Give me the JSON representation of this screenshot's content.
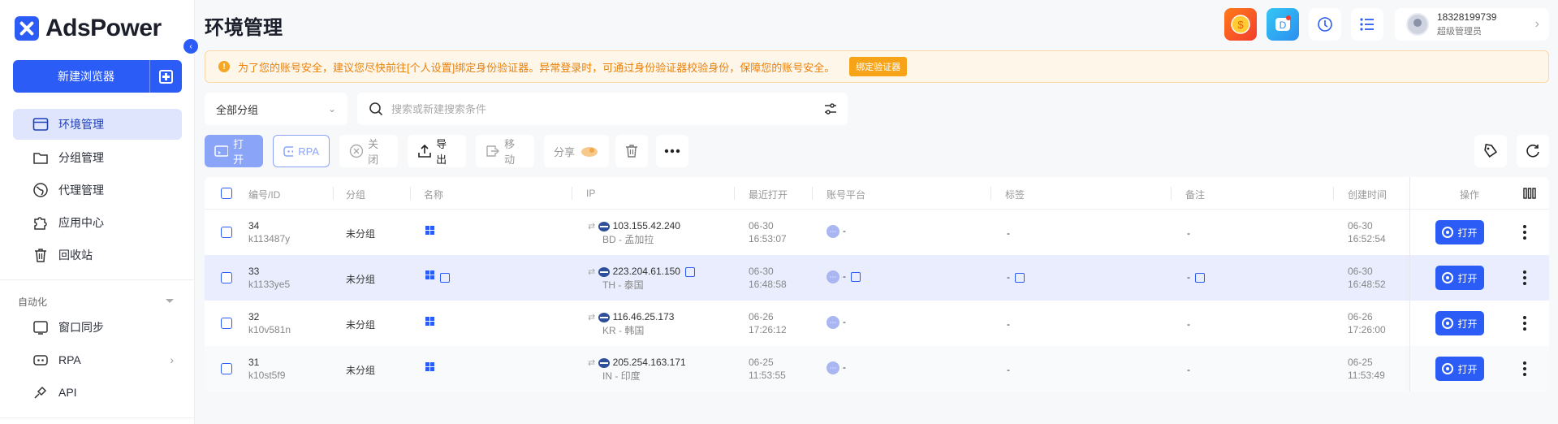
{
  "app": {
    "name": "AdsPower"
  },
  "sidebar": {
    "new_browser": "新建浏览器",
    "items": [
      {
        "label": "环境管理"
      },
      {
        "label": "分组管理"
      },
      {
        "label": "代理管理"
      },
      {
        "label": "应用中心"
      },
      {
        "label": "回收站"
      }
    ],
    "automation_section": "自动化",
    "automation_items": [
      {
        "label": "窗口同步"
      },
      {
        "label": "RPA"
      },
      {
        "label": "API"
      }
    ]
  },
  "header": {
    "title": "环境管理",
    "user": {
      "phone": "18328199739",
      "role": "超级管理员"
    }
  },
  "banner": {
    "message": "为了您的账号安全，建议您尽快前往[个人设置]绑定身份验证器。异常登录时，可通过身份验证器校验身份，保障您的账号安全。",
    "action": "绑定验证器"
  },
  "filters": {
    "group": "全部分组",
    "search_placeholder": "搜索或新建搜索条件"
  },
  "toolbar": {
    "open": "打开",
    "rpa": "RPA",
    "close": "关闭",
    "export": "导出",
    "move": "移动",
    "share": "分享"
  },
  "table": {
    "columns": {
      "id": "编号/ID",
      "group": "分组",
      "name": "名称",
      "ip": "IP",
      "last_open": "最近打开",
      "platform": "账号平台",
      "tags": "标签",
      "note": "备注",
      "created": "创建时间",
      "actions": "操作"
    },
    "open_label": "打开",
    "rows": [
      {
        "num": "34",
        "id": "k113487y",
        "group": "未分组",
        "ip": "103.155.42.240",
        "loc": "BD - 孟加拉",
        "last_date": "06-30",
        "last_time": "16:53:07",
        "platform": "-",
        "tags": "-",
        "note": "-",
        "created_date": "06-30",
        "created_time": "16:52:54"
      },
      {
        "num": "33",
        "id": "k1133ye5",
        "group": "未分组",
        "ip": "223.204.61.150",
        "loc": "TH - 泰国",
        "last_date": "06-30",
        "last_time": "16:48:58",
        "platform": "-",
        "tags": "-",
        "note": "-",
        "created_date": "06-30",
        "created_time": "16:48:52"
      },
      {
        "num": "32",
        "id": "k10v581n",
        "group": "未分组",
        "ip": "116.46.25.173",
        "loc": "KR - 韩国",
        "last_date": "06-26",
        "last_time": "17:26:12",
        "platform": "-",
        "tags": "-",
        "note": "-",
        "created_date": "06-26",
        "created_time": "17:26:00"
      },
      {
        "num": "31",
        "id": "k10st5f9",
        "group": "未分组",
        "ip": "205.254.163.171",
        "loc": "IN - 印度",
        "last_date": "06-25",
        "last_time": "11:53:55",
        "platform": "-",
        "tags": "-",
        "note": "-",
        "created_date": "06-25",
        "created_time": "11:53:49"
      }
    ]
  },
  "colors": {
    "accent": "#2b5cf6",
    "warning": "#f5a623",
    "selected_row": "#e9edfd"
  }
}
